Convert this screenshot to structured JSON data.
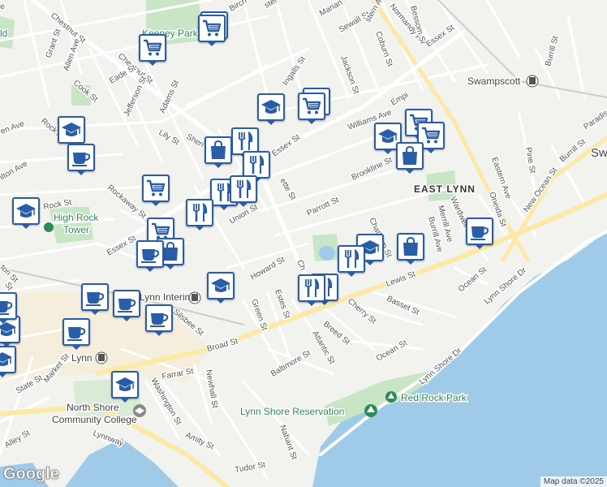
{
  "map": {
    "water_color": "#9fcbe8",
    "park_color": "#c8e6c5",
    "road_color": "#ffffff",
    "major_road_color": "#fbe9a5",
    "land_color": "#f2f2ef"
  },
  "places": {
    "swampscott": "Swampscott",
    "swampscott_edge": "Swa",
    "east_lynn": "EAST LYNN",
    "lynn": "Lynn",
    "lynn_interim": "Lynn Interim",
    "high_rock_tower_1": "High Rock",
    "high_rock_tower_2": "Tower",
    "keeney_park": "Keeney Park",
    "red_rock_park": "Red Rock Park",
    "lynn_shore_reservation": "Lynn Shore Reservation",
    "north_shore_1": "North Shore",
    "north_shore_2": "Community College",
    "edge_ld": "ld"
  },
  "streets": {
    "chestnut_st_1": "Chestnut St",
    "chestnut_st_2": "Chestnut St",
    "birch_st": "Birch St",
    "webster_st": "ster St",
    "marian": "Marian",
    "sewall_st": "Sewall St",
    "eastern_ave_top": "stern Ave",
    "normandy_rd": "Normandy Rd",
    "bessom_st": "Bessom St",
    "essex_st_top": "Essex St",
    "coburn_st": "Coburn St",
    "jackson_st": "Jackson St",
    "ingalls_st": "Ingalls St",
    "grant_st": "Grant St",
    "allen_ave": "Allen Ave",
    "eade_st": "Eade St",
    "cook_st": "Cook St",
    "jefferson_st": "Jefferson St",
    "adams_st": "Adams St",
    "lily_st": "Lily St",
    "sheridan": "Sheri",
    "essex_st_mid": "Essex St",
    "lafayette": "ette St",
    "williams_ave": "Williams Ave",
    "empire": "Empi",
    "brookline_st": "Brookline St",
    "parrott_st": "Parrott St",
    "rock_ave": "Rock Ave",
    "hamilton_ave": "ilton Ave",
    "en_ave": "en Ave",
    "rockaway_st": "Rockaway St",
    "rock_st": "Rock St",
    "union_st": "Union St",
    "essex_st_low": "Essex St",
    "howard_st": "Howard St",
    "chatham_st": "Chatham St",
    "chestnut_st_3": "Ch",
    "green_st": "Green St",
    "estes_st": "Estes St",
    "breed_st": "Breed St",
    "atlantic_st": "Atlantic St",
    "cherry_st": "Cherry St",
    "lewis_st": "Lewis St",
    "basset_st": "Basset St",
    "ocean_st": "Ocean St",
    "ocean_st_2": "Ocean St",
    "broad_st": "Broad St",
    "baltimore_st": "Baltimore St",
    "market_st": "Market St",
    "state_st": "State St",
    "farrar_st": "Farrar St",
    "washington_st": "Washington St",
    "newhall_st": "Newhall St",
    "amity_st": "Amity St",
    "nahant_st": "Nahant St",
    "tudor_st": "Tudor St",
    "lynnway": "Lynnway",
    "alley_st": "Alley St",
    "lynn_shore_dr_1": "Lynn Shore Dr",
    "lynn_shore_dr_2": "Lynn Shore Dr",
    "new_ocean_st": "New Ocean St",
    "pine_st": "Pine St",
    "burrill_st": "Burrill St",
    "burrill_st_top": "Burrill St",
    "oneida_st": "Oneida St",
    "eastern_ave": "Eastern Ave",
    "wardwell_ave": "Wardwell Ave",
    "merrill_ave": "Merrill Ave",
    "burrill_ave": "Burrill Ave",
    "paradise": "Paradis",
    "silsbee": "Silsbee St",
    "edge_st": "St",
    "edge_ton": "ton St",
    "edge_st2": "St",
    "edge_ave": "e"
  },
  "pins": [
    {
      "type": "cart",
      "icon": "shopping-cart-icon"
    },
    {
      "type": "cart",
      "icon": "shopping-cart-icon"
    },
    {
      "type": "cart",
      "icon": "shopping-cart-icon"
    },
    {
      "type": "school",
      "icon": "school-icon"
    },
    {
      "type": "cart",
      "icon": "shopping-cart-icon"
    },
    {
      "type": "cart",
      "icon": "shopping-cart-icon"
    },
    {
      "type": "school",
      "icon": "school-icon"
    },
    {
      "type": "cafe",
      "icon": "coffee-cup-icon"
    },
    {
      "type": "restaurant",
      "icon": "fork-knife-icon"
    },
    {
      "type": "bag",
      "icon": "shopping-bag-icon"
    },
    {
      "type": "restaurant",
      "icon": "fork-knife-icon"
    },
    {
      "type": "school",
      "icon": "school-icon"
    },
    {
      "type": "cart",
      "icon": "shopping-cart-icon"
    },
    {
      "type": "cart",
      "icon": "shopping-cart-icon"
    },
    {
      "type": "bag",
      "icon": "shopping-bag-icon"
    },
    {
      "type": "school",
      "icon": "school-icon"
    },
    {
      "type": "cart",
      "icon": "shopping-cart-icon"
    },
    {
      "type": "restaurant",
      "icon": "fork-knife-icon"
    },
    {
      "type": "restaurant",
      "icon": "fork-knife-icon"
    },
    {
      "type": "restaurant",
      "icon": "fork-knife-icon"
    },
    {
      "type": "cart",
      "icon": "shopping-cart-icon"
    },
    {
      "type": "bag",
      "icon": "shopping-bag-icon"
    },
    {
      "type": "cafe",
      "icon": "coffee-cup-icon"
    },
    {
      "type": "cafe",
      "icon": "coffee-cup-icon"
    },
    {
      "type": "school",
      "icon": "school-icon"
    },
    {
      "type": "restaurant",
      "icon": "fork-knife-icon"
    },
    {
      "type": "school",
      "icon": "school-icon"
    },
    {
      "type": "bag",
      "icon": "shopping-bag-icon"
    },
    {
      "type": "restaurant",
      "icon": "fork-knife-icon"
    },
    {
      "type": "restaurant",
      "icon": "fork-knife-icon"
    },
    {
      "type": "cafe",
      "icon": "coffee-cup-icon"
    },
    {
      "type": "cafe",
      "icon": "coffee-cup-icon"
    },
    {
      "type": "cafe",
      "icon": "coffee-cup-icon"
    },
    {
      "type": "cafe",
      "icon": "coffee-cup-icon"
    },
    {
      "type": "school",
      "icon": "school-icon"
    },
    {
      "type": "cafe",
      "icon": "coffee-cup-icon"
    },
    {
      "type": "school",
      "icon": "school-icon"
    },
    {
      "type": "school",
      "icon": "school-icon"
    }
  ],
  "footer": {
    "logo": "Google",
    "attribution": "Map data ©2025"
  }
}
